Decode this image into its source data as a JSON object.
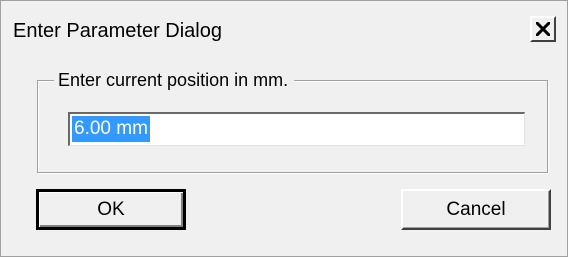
{
  "dialog": {
    "title": "Enter Parameter Dialog",
    "close_icon": "close-x-icon"
  },
  "group": {
    "legend": "Enter current position in mm."
  },
  "input": {
    "value": "6.00 mm",
    "selected": true
  },
  "buttons": {
    "ok_label": "OK",
    "cancel_label": "Cancel"
  },
  "colors": {
    "window_bg": "#f0f0f0",
    "selection_bg": "#3399ff",
    "selection_text": "#ffffff"
  }
}
